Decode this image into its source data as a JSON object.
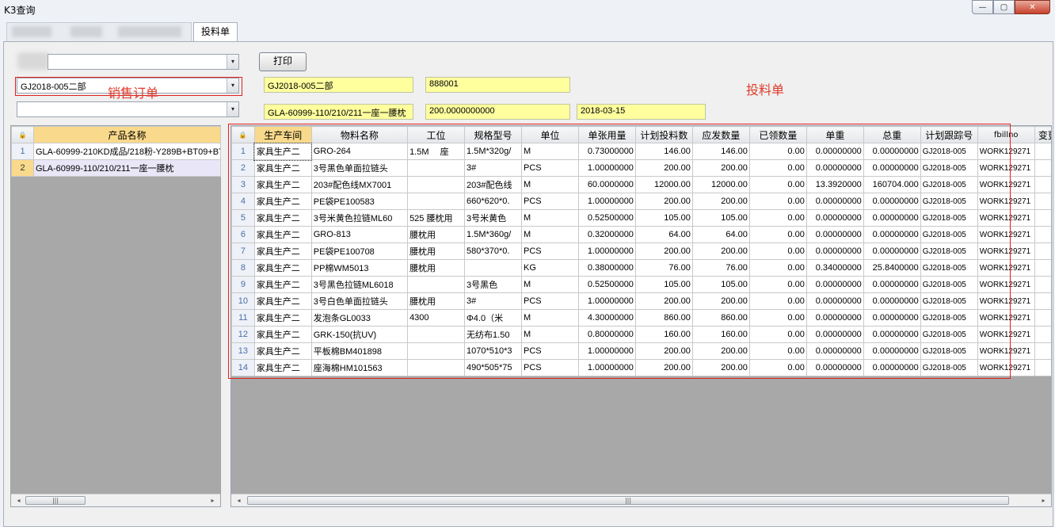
{
  "window": {
    "title": "K3查询",
    "min": "—",
    "max": "▢",
    "close": "✕"
  },
  "tabs": {
    "active": "投料单"
  },
  "controls": {
    "print_label": "打印",
    "combo_sales_order": "GJ2018-005二部",
    "combo_product": "",
    "yellow1": "GJ2018-005二部",
    "yellow2": "888001",
    "yellow3": "GLA-60999-110/210/211一座一腰枕",
    "yellow4": "200.0000000000",
    "yellow5": "2018-03-15"
  },
  "annotations": {
    "sales_order_label": "销售订单",
    "bom_label": "投料单"
  },
  "left_grid": {
    "header": "产品名称",
    "rows": [
      {
        "n": "1",
        "name": "GLA-60999-210KD成品/218粉-Y289B+BT09+BT"
      },
      {
        "n": "2",
        "name": "GLA-60999-110/210/211一座一腰枕"
      }
    ]
  },
  "right_grid": {
    "columns": [
      "生产车间",
      "物料名称",
      "工位",
      "规格型号",
      "单位",
      "单张用量",
      "计划投料数",
      "应发数量",
      "已领数量",
      "单重",
      "总重",
      "计划跟踪号",
      "fbillno",
      "变更发"
    ],
    "rows": [
      [
        "1",
        "家具生产二",
        "GRO-264",
        "1.5M　 座",
        "1.5M*320g/",
        "M",
        "0.73000000",
        "146.00",
        "146.00",
        "0.00",
        "0.00000000",
        "0.00000000",
        "GJ2018-005",
        "WORK129271"
      ],
      [
        "2",
        "家具生产二",
        "3号黑色单面拉链头",
        "",
        "3#",
        "PCS",
        "1.00000000",
        "200.00",
        "200.00",
        "0.00",
        "0.00000000",
        "0.00000000",
        "GJ2018-005",
        "WORK129271"
      ],
      [
        "3",
        "家具生产二",
        "203#配色线MX7001",
        "",
        "203#配色线",
        "M",
        "60.0000000",
        "12000.00",
        "12000.00",
        "0.00",
        "13.3920000",
        "160704.000",
        "GJ2018-005",
        "WORK129271"
      ],
      [
        "4",
        "家具生产二",
        "PE袋PE100583",
        "",
        "660*620*0.",
        "PCS",
        "1.00000000",
        "200.00",
        "200.00",
        "0.00",
        "0.00000000",
        "0.00000000",
        "GJ2018-005",
        "WORK129271"
      ],
      [
        "5",
        "家具生产二",
        "3号米黄色拉链ML60",
        "525 腰枕用",
        "3号米黄色",
        "M",
        "0.52500000",
        "105.00",
        "105.00",
        "0.00",
        "0.00000000",
        "0.00000000",
        "GJ2018-005",
        "WORK129271"
      ],
      [
        "6",
        "家具生产二",
        "GRO-813",
        "腰枕用",
        "1.5M*360g/",
        "M",
        "0.32000000",
        "64.00",
        "64.00",
        "0.00",
        "0.00000000",
        "0.00000000",
        "GJ2018-005",
        "WORK129271"
      ],
      [
        "7",
        "家具生产二",
        "PE袋PE100708",
        "腰枕用",
        "580*370*0.",
        "PCS",
        "1.00000000",
        "200.00",
        "200.00",
        "0.00",
        "0.00000000",
        "0.00000000",
        "GJ2018-005",
        "WORK129271"
      ],
      [
        "8",
        "家具生产二",
        "PP棉WM5013",
        "腰枕用",
        "",
        "KG",
        "0.38000000",
        "76.00",
        "76.00",
        "0.00",
        "0.34000000",
        "25.8400000",
        "GJ2018-005",
        "WORK129271"
      ],
      [
        "9",
        "家具生产二",
        "3号黑色拉链ML6018",
        "",
        "3号黑色",
        "M",
        "0.52500000",
        "105.00",
        "105.00",
        "0.00",
        "0.00000000",
        "0.00000000",
        "GJ2018-005",
        "WORK129271"
      ],
      [
        "10",
        "家具生产二",
        "3号白色单面拉链头",
        "腰枕用",
        "3#",
        "PCS",
        "1.00000000",
        "200.00",
        "200.00",
        "0.00",
        "0.00000000",
        "0.00000000",
        "GJ2018-005",
        "WORK129271"
      ],
      [
        "11",
        "家具生产二",
        "发泡条GL0033",
        "4300",
        "Φ4.0（米",
        "M",
        "4.30000000",
        "860.00",
        "860.00",
        "0.00",
        "0.00000000",
        "0.00000000",
        "GJ2018-005",
        "WORK129271"
      ],
      [
        "12",
        "家具生产二",
        "GRK-150(抗UV)",
        "",
        "无纺布1.50",
        "M",
        "0.80000000",
        "160.00",
        "160.00",
        "0.00",
        "0.00000000",
        "0.00000000",
        "GJ2018-005",
        "WORK129271"
      ],
      [
        "13",
        "家具生产二",
        "平板棉BM401898",
        "",
        "1070*510*3",
        "PCS",
        "1.00000000",
        "200.00",
        "200.00",
        "0.00",
        "0.00000000",
        "0.00000000",
        "GJ2018-005",
        "WORK129271"
      ],
      [
        "14",
        "家具生产二",
        "座海棉HM101563",
        "",
        "490*505*75",
        "PCS",
        "1.00000000",
        "200.00",
        "200.00",
        "0.00",
        "0.00000000",
        "0.00000000",
        "GJ2018-005",
        "WORK129271"
      ]
    ]
  },
  "icons": {
    "dropdown": "▾",
    "lock": "🔒",
    "left": "◂",
    "right": "▸",
    "grip": "|||"
  }
}
